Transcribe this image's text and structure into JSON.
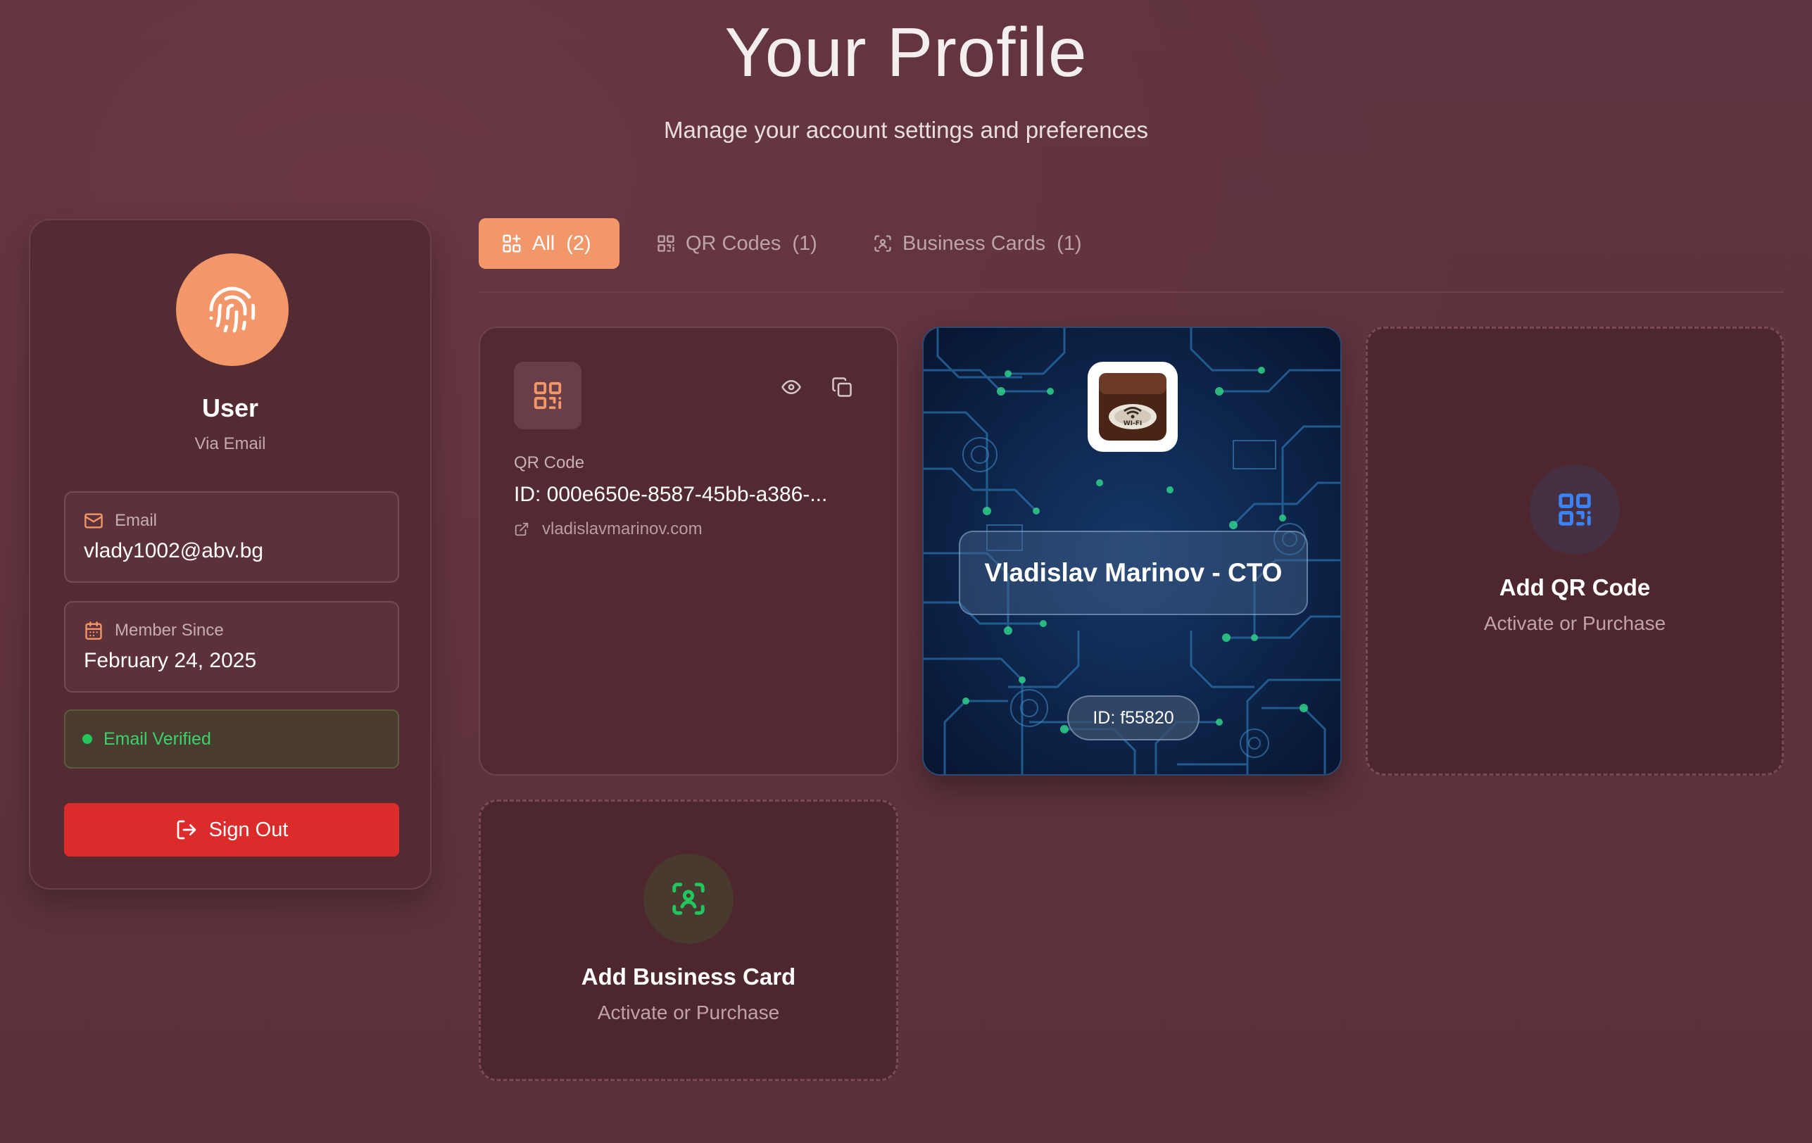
{
  "page": {
    "title": "Your Profile",
    "subtitle": "Manage your account settings and preferences"
  },
  "profile": {
    "name": "User",
    "provider": "Via Email",
    "avatar_icon": "fingerprint-icon",
    "email_label": "Email",
    "email_value": "vlady1002@abv.bg",
    "member_label": "Member Since",
    "member_value": "February 24, 2025",
    "verified_text": "Email Verified",
    "signout_label": "Sign Out"
  },
  "tabs": [
    {
      "label": "All",
      "count": "(2)",
      "icon": "grid-plus-icon",
      "active": true
    },
    {
      "label": "QR Codes",
      "count": "(1)",
      "icon": "qr-code-icon",
      "active": false
    },
    {
      "label": "Business Cards",
      "count": "(1)",
      "icon": "scan-face-icon",
      "active": false
    }
  ],
  "qr_card": {
    "type_label": "QR Code",
    "id_text": "ID: 000e650e-8587-45bb-a386-...",
    "link": "vladislavmarinov.com",
    "actions": [
      "eye-icon",
      "copy-icon"
    ]
  },
  "business_card": {
    "name": "Vladislav Marinov - CTO",
    "id_text": "ID: f55820",
    "logo_text": "WI-FI"
  },
  "add_qr": {
    "title": "Add QR Code",
    "subtitle": "Activate or Purchase"
  },
  "add_business": {
    "title": "Add Business Card",
    "subtitle": "Activate or Purchase"
  },
  "colors": {
    "background": "#5e323b",
    "accent": "#f2976a",
    "danger": "#dc2b2b",
    "success": "#22c55e",
    "qr_blue": "#3b82f6"
  }
}
